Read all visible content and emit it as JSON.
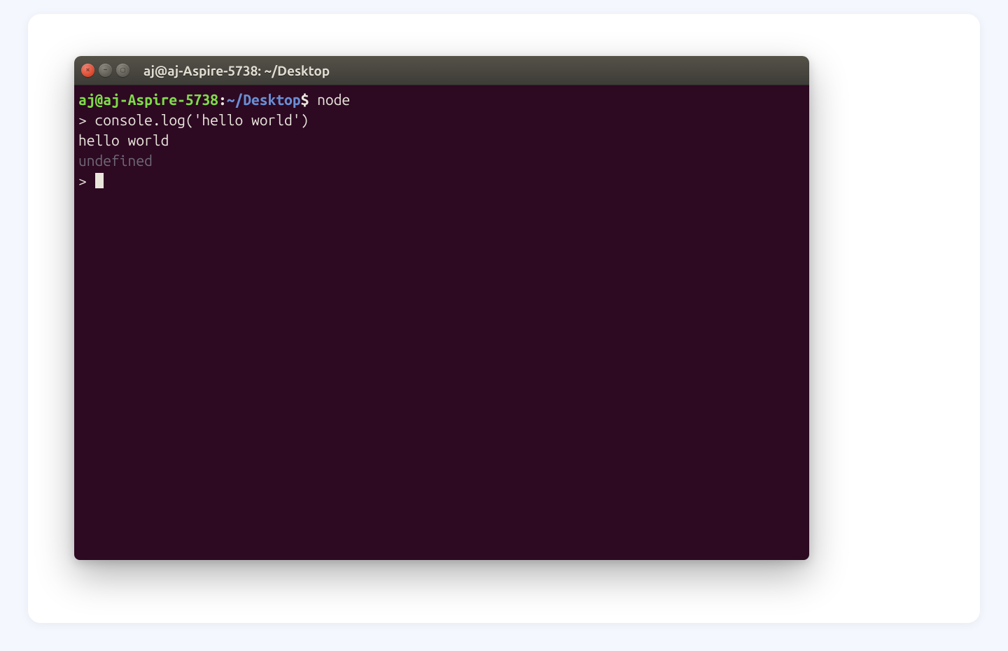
{
  "window": {
    "title": "aj@aj-Aspire-5738: ~/Desktop",
    "buttons": {
      "close_glyph": "×",
      "min_glyph": "–",
      "max_glyph": "▢"
    }
  },
  "prompt": {
    "user": "aj",
    "at": "@",
    "host": "aj-Aspire-5738",
    "colon": ":",
    "path": "~/Desktop",
    "sigil": "$"
  },
  "session": {
    "command_at_shell": "node",
    "repl_prompt": ">",
    "repl_input_1": "console.log('hello world')",
    "stdout_1": "hello world",
    "return_1": "undefined"
  }
}
